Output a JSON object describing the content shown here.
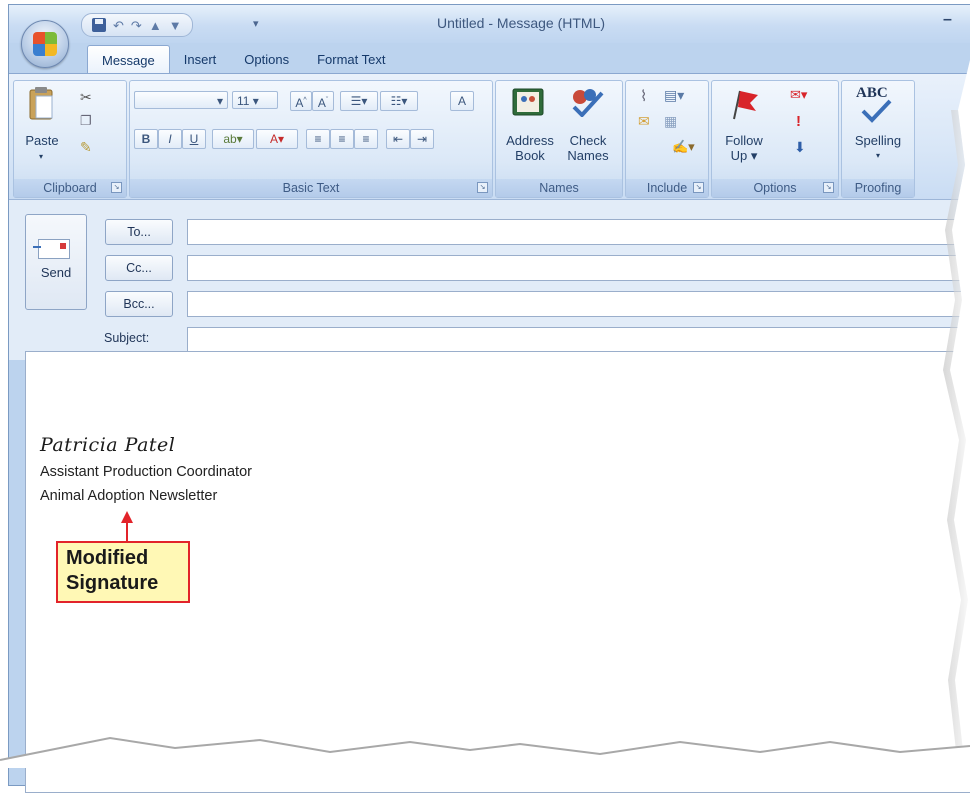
{
  "window": {
    "title": "Untitled - Message (HTML)",
    "minimize": "–"
  },
  "tabs": [
    "Message",
    "Insert",
    "Options",
    "Format Text"
  ],
  "ribbon": {
    "clipboard": {
      "label": "Clipboard",
      "paste": "Paste"
    },
    "basic_text": {
      "label": "Basic Text",
      "font_size": "11",
      "bold": "B",
      "italic": "I",
      "underline": "U"
    },
    "names": {
      "label": "Names",
      "address_book_1": "Address",
      "address_book_2": "Book",
      "check_names_1": "Check",
      "check_names_2": "Names"
    },
    "include": {
      "label": "Include"
    },
    "options": {
      "label": "Options",
      "follow_up_1": "Follow",
      "follow_up_2": "Up"
    },
    "proofing": {
      "label": "Proofing",
      "spelling": "Spelling",
      "abc": "ABC"
    }
  },
  "compose": {
    "send": "Send",
    "to": "To...",
    "cc": "Cc...",
    "bcc": "Bcc...",
    "subject_label": "Subject:",
    "to_value": "",
    "cc_value": "",
    "bcc_value": "",
    "subject_value": ""
  },
  "signature": {
    "name": "Patricia Patel",
    "title": "Assistant Production Coordinator",
    "org": "Animal Adoption Newsletter"
  },
  "callout": {
    "line1": "Modified",
    "line2": "Signature"
  },
  "colors": {
    "accent": "#e2232a",
    "callout_fill": "#fff8b5",
    "ribbon": "#d8e6f7"
  }
}
